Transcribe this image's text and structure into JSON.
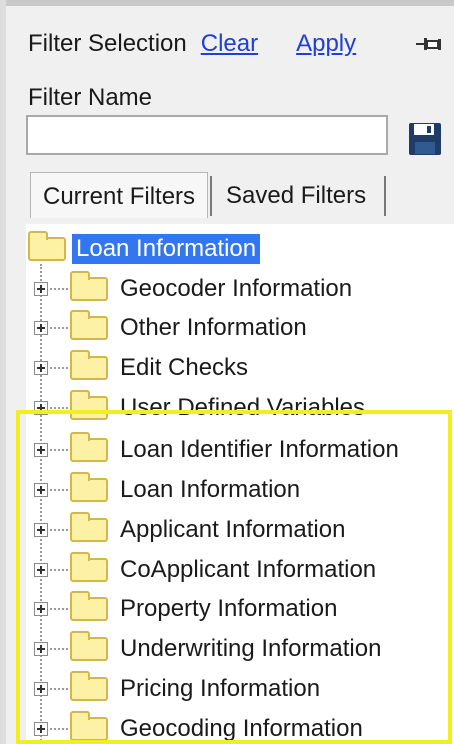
{
  "header": {
    "title": "Filter Selection",
    "clear_label": "Clear",
    "apply_label": "Apply"
  },
  "filter_name": {
    "label": "Filter Name",
    "value": ""
  },
  "tabs": [
    {
      "label": "Current Filters",
      "active": true
    },
    {
      "label": "Saved Filters",
      "active": false
    }
  ],
  "tree": {
    "root": {
      "label": "Loan Information",
      "selected": true
    },
    "children": [
      {
        "label": "Geocoder Information"
      },
      {
        "label": "Other Information"
      },
      {
        "label": "Edit Checks"
      },
      {
        "label": "User Defined Variables"
      },
      {
        "label": "Loan Identifier Information"
      },
      {
        "label": "Loan Information"
      },
      {
        "label": "Applicant Information"
      },
      {
        "label": "CoApplicant Information"
      },
      {
        "label": "Property Information"
      },
      {
        "label": "Underwriting Information"
      },
      {
        "label": "Pricing Information"
      },
      {
        "label": "Geocoding Information"
      }
    ]
  },
  "colors": {
    "link": "#1f3fd6",
    "selection": "#3377f0",
    "folder_fill": "#fdf1a5",
    "highlight_border": "#f2ef1e"
  },
  "icons": {
    "pin": "pin-icon",
    "save": "save-disk-icon",
    "folder": "folder-icon",
    "expand": "plus-expand-icon"
  }
}
